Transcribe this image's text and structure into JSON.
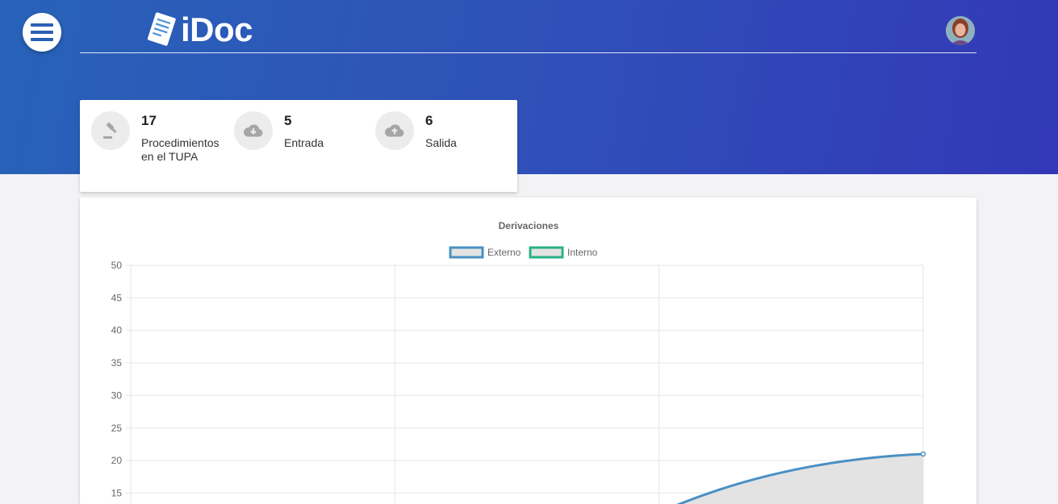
{
  "header": {
    "app_name": "iDoc",
    "menu_icon": "hamburger-menu-icon",
    "logo_icon": "document-icon",
    "avatar_icon": "user-avatar",
    "accent_color": "#2b5fb5"
  },
  "stats": [
    {
      "icon": "gavel-icon",
      "value": "17",
      "label": "Procedimientos",
      "label2": "en el TUPA"
    },
    {
      "icon": "cloud-download-icon",
      "value": "5",
      "label": "Entrada"
    },
    {
      "icon": "cloud-upload-icon",
      "value": "6",
      "label": "Salida"
    }
  ],
  "chart_data": {
    "type": "line",
    "title": "Derivaciones",
    "ylim": [
      0,
      50
    ],
    "y_ticks": [
      "50",
      "45",
      "40",
      "35",
      "30",
      "25",
      "20",
      "15"
    ],
    "x_categories": 4,
    "grid": true,
    "legend_position": "top-center",
    "series": [
      {
        "name": "Externo",
        "color": "#4a90c4",
        "fill": "#e3e3e3",
        "values_visible": [
          null,
          null,
          12,
          21
        ]
      },
      {
        "name": "Interno",
        "color": "#2ab088",
        "fill": "#e3e3e3",
        "values_visible": []
      }
    ]
  }
}
